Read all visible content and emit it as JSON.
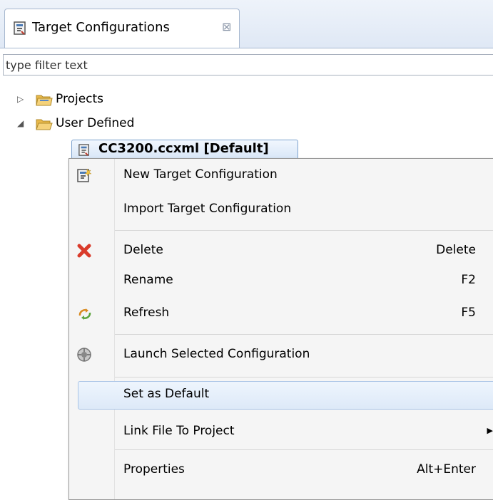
{
  "view": {
    "tab_title": "Target Configurations",
    "close_glyph": "⊠",
    "icons": {
      "tab": "target-config-icon",
      "close": "close-icon"
    }
  },
  "filter": {
    "placeholder": "type filter text",
    "value": ""
  },
  "tree": {
    "items": [
      {
        "label": "Projects",
        "expanded": false,
        "twisty": "▷"
      },
      {
        "label": "User Defined",
        "expanded": true,
        "twisty": "◢"
      }
    ],
    "selected_file": "CC3200.ccxml [Default]"
  },
  "context_menu": {
    "items": [
      {
        "label": "New Target Configuration",
        "shortcut": "",
        "icon": "new-target-config-icon"
      },
      {
        "label": "Import Target Configuration",
        "shortcut": "",
        "icon": ""
      },
      {
        "label": "Delete",
        "shortcut": "Delete",
        "icon": "delete-icon"
      },
      {
        "label": "Rename",
        "shortcut": "F2",
        "icon": ""
      },
      {
        "label": "Refresh",
        "shortcut": "F5",
        "icon": "refresh-icon"
      },
      {
        "label": "Launch Selected Configuration",
        "shortcut": "",
        "icon": "launch-icon"
      },
      {
        "label": "Set as Default",
        "shortcut": "",
        "icon": "",
        "hovered": true
      },
      {
        "label": "Link File To Project",
        "shortcut": "",
        "icon": "",
        "submenu_arrow": "▶"
      },
      {
        "label": "Properties",
        "shortcut": "Alt+Enter",
        "icon": ""
      }
    ]
  },
  "colors": {
    "folder": "#e8b84a",
    "delete_red": "#d93b2b",
    "selection_border": "#7da2ce",
    "hover_border": "#a9c4e6"
  }
}
